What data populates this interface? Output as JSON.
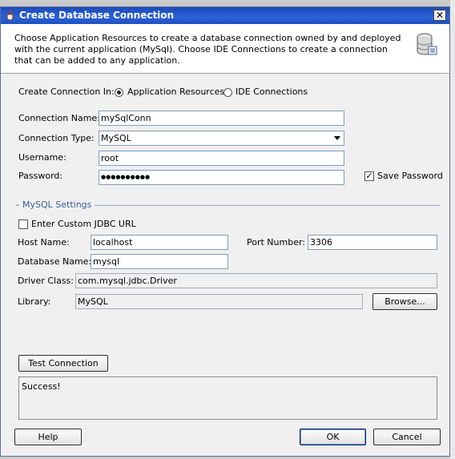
{
  "window": {
    "title": "Create Database Connection",
    "close_glyph": "✕"
  },
  "banner": {
    "description": "Choose Application Resources to create a database connection owned by and deployed with the current application (MySql). Choose IDE Connections to create a connection that can be added to any application."
  },
  "create_in": {
    "label": "Create Connection In:",
    "options": [
      {
        "label": "Application Resources",
        "selected": true
      },
      {
        "label": "IDE Connections",
        "selected": false
      }
    ]
  },
  "form": {
    "connection_name": {
      "label": "Connection Name:",
      "value": "mySqlConn"
    },
    "connection_type": {
      "label": "Connection Type:",
      "value": "MySQL"
    },
    "username": {
      "label": "Username:",
      "value": "root"
    },
    "password": {
      "label": "Password:",
      "value": "●●●●●●●●●●"
    },
    "save_password": {
      "label": "Save Password",
      "checked": true
    }
  },
  "mysql_settings": {
    "title": "MySQL Settings",
    "custom_jdbc": {
      "label": "Enter Custom JDBC URL",
      "checked": false
    },
    "host_name": {
      "label": "Host Name:",
      "value": "localhost"
    },
    "port_number": {
      "label": "Port Number:",
      "value": "3306"
    },
    "database_name": {
      "label": "Database Name:",
      "value": "mysql"
    },
    "driver_class": {
      "label": "Driver Class:",
      "value": "com.mysql.jdbc.Driver"
    },
    "library": {
      "label": "Library:",
      "value": "MySQL"
    },
    "browse_label": "Browse..."
  },
  "test": {
    "button_label": "Test Connection",
    "result": "Success!"
  },
  "footer": {
    "help_label": "Help",
    "ok_label": "OK",
    "cancel_label": "Cancel"
  },
  "colors": {
    "title_bar": "#2b62d9",
    "section_title": "#3a5d95"
  }
}
